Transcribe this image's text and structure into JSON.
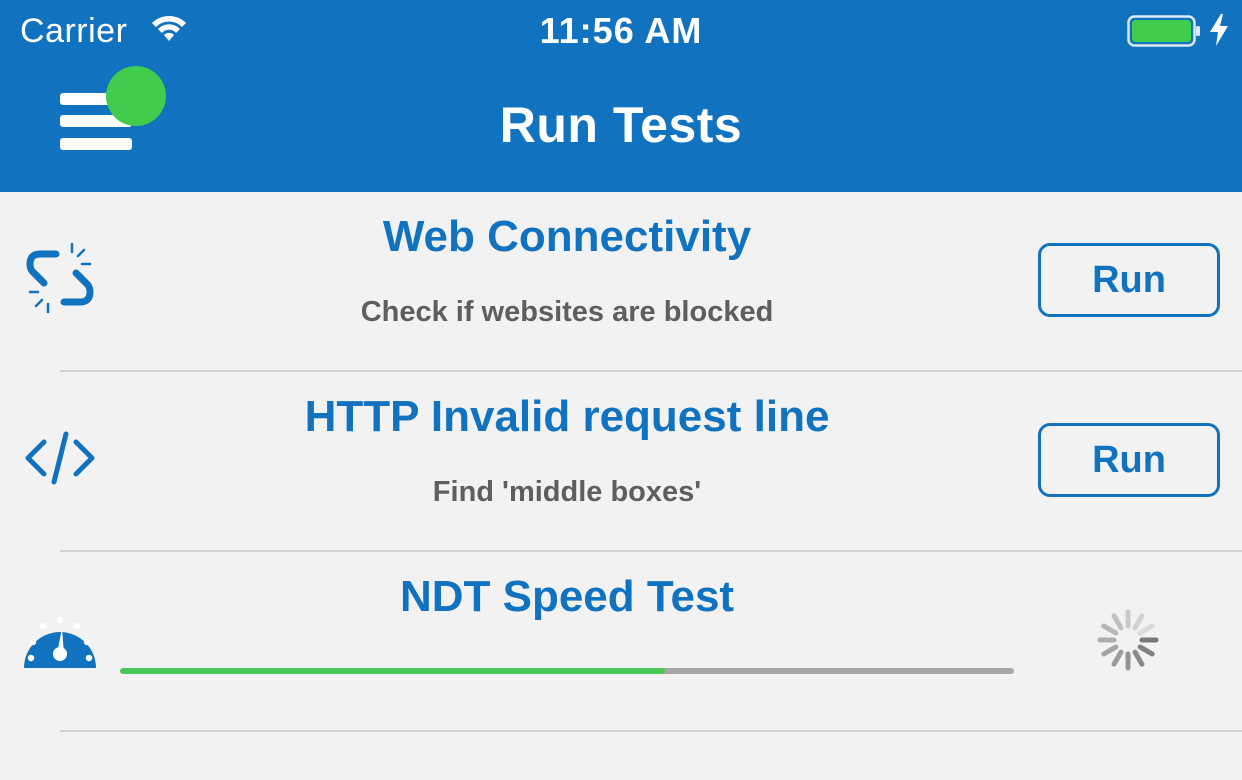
{
  "status_bar": {
    "carrier": "Carrier",
    "time": "11:56 AM",
    "icons": [
      "wifi-icon",
      "battery-icon",
      "charging-icon"
    ],
    "battery_color": "#40cc4d"
  },
  "header": {
    "title": "Run Tests",
    "background_color": "#1173bf",
    "menu_icon": "hamburger-menu-icon",
    "notification_dot_color": "#40cc4d"
  },
  "tests": [
    {
      "title": "Web Connectivity",
      "description": "Check if websites are blocked",
      "icon": "broken-link-icon",
      "action_label": "Run"
    },
    {
      "title": "HTTP Invalid request line",
      "description": "Find 'middle boxes'",
      "icon": "code-tag-icon",
      "action_label": "Run"
    },
    {
      "title": "NDT Speed Test",
      "icon": "speedometer-icon",
      "status": "running",
      "progress": 0.61,
      "progress_color": "#4bc85a",
      "activity_indicator": "spinner-icon"
    }
  ],
  "accent_color": "#1173bf"
}
